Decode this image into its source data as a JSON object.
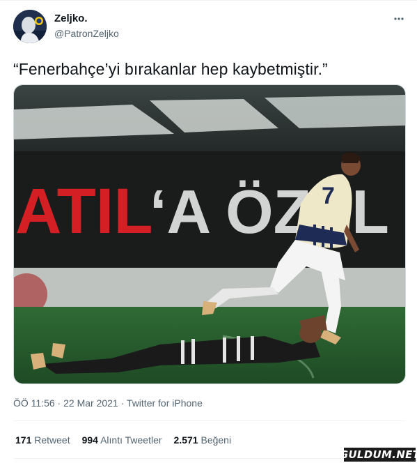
{
  "user": {
    "name": "Zeljko.",
    "handle": "@PatronZeljko"
  },
  "tweet": {
    "text": "“Fenerbahçe’yi bırakanlar hep kaybetmiştir.”",
    "timestamp": "ÖÖ 11:56 · 22 Mar 2021",
    "separator": " · ",
    "source": "Twitter for iPhone"
  },
  "media": {
    "banner_left": "ATIL",
    "banner_right": "‘A ÖZEL İÇ",
    "player_number": "7"
  },
  "stats": {
    "retweets": {
      "count": "171",
      "label": "Retweet"
    },
    "quotes": {
      "count": "994",
      "label": "Alıntı Tweetler"
    },
    "likes": {
      "count": "2.571",
      "label": "Beğeni"
    }
  },
  "watermark": "GULDUM.NET",
  "icons": [
    "more-icon"
  ],
  "colors": {
    "text": "#0f1419",
    "secondary": "#536471",
    "divider": "#eff3f4",
    "banner_red": "#d42025"
  }
}
